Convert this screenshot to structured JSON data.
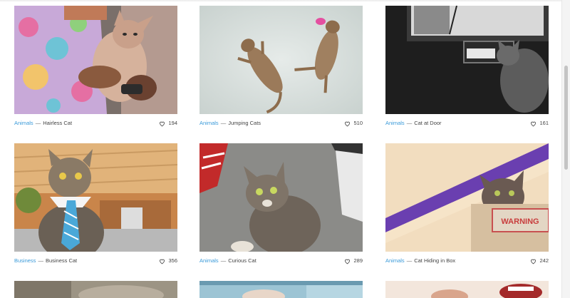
{
  "gallery": {
    "cards": [
      {
        "category": "Animals",
        "separator": "—",
        "title": "Hairless Cat",
        "likes": "194"
      },
      {
        "category": "Animals",
        "separator": "—",
        "title": "Jumping Cats",
        "likes": "510"
      },
      {
        "category": "Animals",
        "separator": "—",
        "title": "Cat at Door",
        "likes": "161"
      },
      {
        "category": "Business",
        "separator": "—",
        "title": "Business Cat",
        "likes": "356"
      },
      {
        "category": "Animals",
        "separator": "—",
        "title": "Curious Cat",
        "likes": "289"
      },
      {
        "category": "Animals",
        "separator": "—",
        "title": "Cat Hiding in Box",
        "likes": "242"
      }
    ],
    "box_sign_text": "WARNING"
  },
  "icons": {
    "like": "heart-outline-icon"
  },
  "colors": {
    "category_link": "#3a9ad9",
    "text": "#444444",
    "background": "#ffffff"
  }
}
